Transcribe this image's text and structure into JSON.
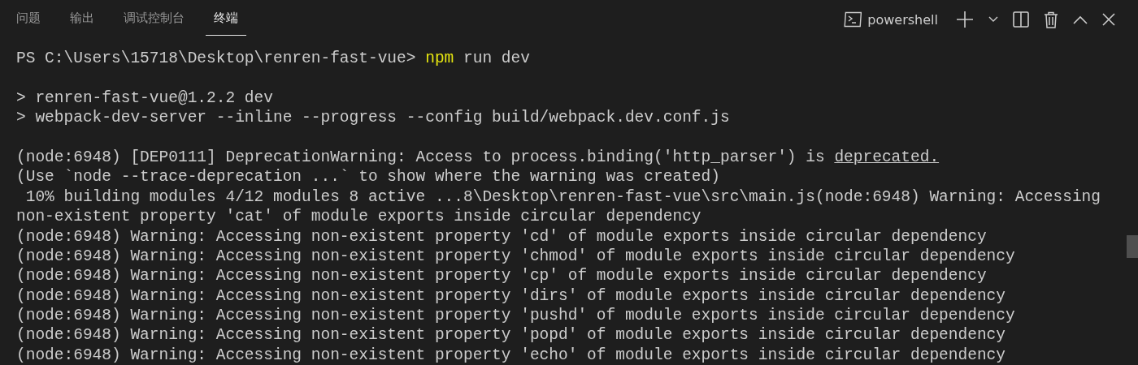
{
  "tabs": [
    {
      "label": "问题",
      "selected": false
    },
    {
      "label": "输出",
      "selected": false
    },
    {
      "label": "调试控制台",
      "selected": false
    },
    {
      "label": "终端",
      "selected": true
    }
  ],
  "terminal_picker": {
    "label": "powershell"
  },
  "lines": [
    {
      "kind": "prompt",
      "prompt": "PS C:\\Users\\15718\\Desktop\\renren-fast-vue>",
      "command": "npm",
      "args": "run dev"
    },
    {
      "kind": "blank"
    },
    {
      "kind": "text",
      "text": "> renren-fast-vue@1.2.2 dev"
    },
    {
      "kind": "text",
      "text": "> webpack-dev-server --inline --progress --config build/webpack.dev.conf.js"
    },
    {
      "kind": "blank"
    },
    {
      "kind": "link",
      "text": "(node:6948) [DEP0111] DeprecationWarning: Access to process.binding('http_parser') is",
      "link": "deprecated."
    },
    {
      "kind": "text",
      "text": "(Use `node --trace-deprecation ...` to show where the warning was created)"
    },
    {
      "kind": "text",
      "text": " 10% building modules 4/12 modules 8 active ...8\\Desktop\\renren-fast-vue\\src\\main.js(node:6948) Warning: Accessing"
    },
    {
      "kind": "text",
      "text": "non-existent property 'cat' of module exports inside circular dependency"
    },
    {
      "kind": "text",
      "text": "(node:6948) Warning: Accessing non-existent property 'cd' of module exports inside circular dependency"
    },
    {
      "kind": "text",
      "text": "(node:6948) Warning: Accessing non-existent property 'chmod' of module exports inside circular dependency"
    },
    {
      "kind": "text",
      "text": "(node:6948) Warning: Accessing non-existent property 'cp' of module exports inside circular dependency"
    },
    {
      "kind": "text",
      "text": "(node:6948) Warning: Accessing non-existent property 'dirs' of module exports inside circular dependency"
    },
    {
      "kind": "text",
      "text": "(node:6948) Warning: Accessing non-existent property 'pushd' of module exports inside circular dependency"
    },
    {
      "kind": "text",
      "text": "(node:6948) Warning: Accessing non-existent property 'popd' of module exports inside circular dependency"
    },
    {
      "kind": "text",
      "text": "(node:6948) Warning: Accessing non-existent property 'echo' of module exports inside circular dependency"
    }
  ]
}
